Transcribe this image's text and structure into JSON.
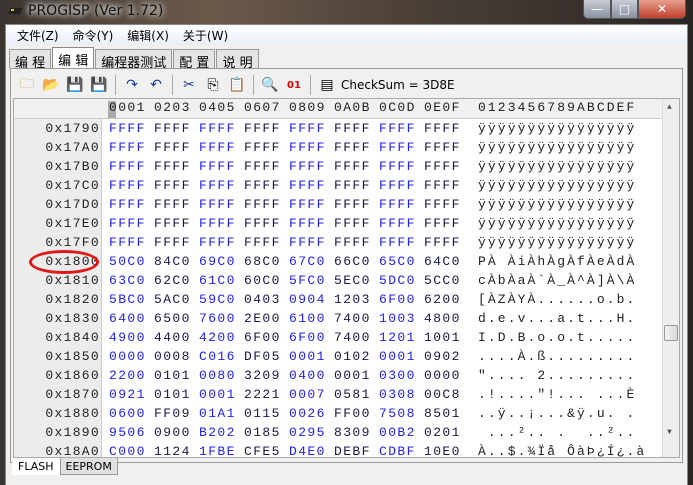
{
  "window": {
    "title": "PROGISP (Ver 1.72)",
    "minimize": "—",
    "maximize": "□",
    "close": "✕"
  },
  "menu": [
    "文件(Z)",
    "命令(Y)",
    "编辑(X)",
    "关于(W)"
  ],
  "tabs": [
    {
      "label": "编 程",
      "active": false
    },
    {
      "label": "编 辑",
      "active": true
    },
    {
      "label": "编程器测试",
      "active": false
    },
    {
      "label": "配 置",
      "active": false
    },
    {
      "label": "说 明",
      "active": false
    }
  ],
  "toolbar": {
    "icons": [
      "open-folder-icon",
      "load-file-icon",
      "save-icon",
      "save-as-icon",
      "redo-icon",
      "undo-icon",
      "cut-icon",
      "copy-icon",
      "paste-icon",
      "find-icon",
      "binary-icon",
      "checksum-icon"
    ],
    "checksum": "CheckSum = 3D8E"
  },
  "hex": {
    "header": [
      "0001",
      "0203",
      "0405",
      "0607",
      "0809",
      "0A0B",
      "0C0D",
      "0E0F"
    ],
    "ascii_header": "0123456789ABCDEF",
    "rows": [
      {
        "addr": "0x1790",
        "cells": [
          "FFFF",
          "FFFF",
          "FFFF",
          "FFFF",
          "FFFF",
          "FFFF",
          "FFFF",
          "FFFF"
        ],
        "ascii": "ÿÿÿÿÿÿÿÿÿÿÿÿÿÿÿÿ"
      },
      {
        "addr": "0x17A0",
        "cells": [
          "FFFF",
          "FFFF",
          "FFFF",
          "FFFF",
          "FFFF",
          "FFFF",
          "FFFF",
          "FFFF"
        ],
        "ascii": "ÿÿÿÿÿÿÿÿÿÿÿÿÿÿÿÿ"
      },
      {
        "addr": "0x17B0",
        "cells": [
          "FFFF",
          "FFFF",
          "FFFF",
          "FFFF",
          "FFFF",
          "FFFF",
          "FFFF",
          "FFFF"
        ],
        "ascii": "ÿÿÿÿÿÿÿÿÿÿÿÿÿÿÿÿ"
      },
      {
        "addr": "0x17C0",
        "cells": [
          "FFFF",
          "FFFF",
          "FFFF",
          "FFFF",
          "FFFF",
          "FFFF",
          "FFFF",
          "FFFF"
        ],
        "ascii": "ÿÿÿÿÿÿÿÿÿÿÿÿÿÿÿÿ"
      },
      {
        "addr": "0x17D0",
        "cells": [
          "FFFF",
          "FFFF",
          "FFFF",
          "FFFF",
          "FFFF",
          "FFFF",
          "FFFF",
          "FFFF"
        ],
        "ascii": "ÿÿÿÿÿÿÿÿÿÿÿÿÿÿÿÿ"
      },
      {
        "addr": "0x17E0",
        "cells": [
          "FFFF",
          "FFFF",
          "FFFF",
          "FFFF",
          "FFFF",
          "FFFF",
          "FFFF",
          "FFFF"
        ],
        "ascii": "ÿÿÿÿÿÿÿÿÿÿÿÿÿÿÿÿ"
      },
      {
        "addr": "0x17F0",
        "cells": [
          "FFFF",
          "FFFF",
          "FFFF",
          "FFFF",
          "FFFF",
          "FFFF",
          "FFFF",
          "FFFF"
        ],
        "ascii": "ÿÿÿÿÿÿÿÿÿÿÿÿÿÿÿÿ"
      },
      {
        "addr": "0x1800",
        "cells": [
          "50C0",
          "84C0",
          "69C0",
          "68C0",
          "67C0",
          "66C0",
          "65C0",
          "64C0"
        ],
        "ascii": "PÀ ÀiÀhÀgÀfÀeÀdÀ"
      },
      {
        "addr": "0x1810",
        "cells": [
          "63C0",
          "62C0",
          "61C0",
          "60C0",
          "5FC0",
          "5EC0",
          "5DC0",
          "5CC0"
        ],
        "ascii": "cÀbÀaÀ`À_À^À]À\\À"
      },
      {
        "addr": "0x1820",
        "cells": [
          "5BC0",
          "5AC0",
          "59C0",
          "0403",
          "0904",
          "1203",
          "6F00",
          "6200"
        ],
        "ascii": "[ÀZÀYÀ......o.b."
      },
      {
        "addr": "0x1830",
        "cells": [
          "6400",
          "6500",
          "7600",
          "2E00",
          "6100",
          "7400",
          "1003",
          "4800"
        ],
        "ascii": "d.e.v...a.t...H."
      },
      {
        "addr": "0x1840",
        "cells": [
          "4900",
          "4400",
          "4200",
          "6F00",
          "6F00",
          "7400",
          "1201",
          "1001"
        ],
        "ascii": "I.D.B.o.o.t....."
      },
      {
        "addr": "0x1850",
        "cells": [
          "0000",
          "0008",
          "C016",
          "DF05",
          "0001",
          "0102",
          "0001",
          "0902"
        ],
        "ascii": "....À.ß........."
      },
      {
        "addr": "0x1860",
        "cells": [
          "2200",
          "0101",
          "0080",
          "3209",
          "0400",
          "0001",
          "0300",
          "0000"
        ],
        "ascii": "\".... 2........."
      },
      {
        "addr": "0x1870",
        "cells": [
          "0921",
          "0101",
          "0001",
          "2221",
          "0007",
          "0581",
          "0308",
          "00C8"
        ],
        "ascii": ".!....\"!... ...È"
      },
      {
        "addr": "0x1880",
        "cells": [
          "0600",
          "FF09",
          "01A1",
          "0115",
          "0026",
          "FF00",
          "7508",
          "8501"
        ],
        "ascii": "..ÿ..¡...&ÿ.u. ."
      },
      {
        "addr": "0x1890",
        "cells": [
          "9506",
          "0900",
          "B202",
          "0185",
          "0295",
          "8309",
          "00B2",
          "0201"
        ],
        "ascii": " ...².. .  ..².."
      },
      {
        "addr": "0x18A0",
        "cells": [
          "C000",
          "1124",
          "1FBE",
          "CFE5",
          "D4E0",
          "DEBF",
          "CDBF",
          "10E0"
        ],
        "ascii": "À..$.¾Ïå ÔàÞ¿Í¿.à"
      }
    ]
  },
  "bottom_tabs": [
    {
      "label": "FLASH",
      "active": true
    },
    {
      "label": "EEPROM",
      "active": false
    }
  ],
  "colors": {
    "hex_odd": "#2020f0",
    "hex_even": "#181848",
    "highlight_circle": "#e01818"
  }
}
